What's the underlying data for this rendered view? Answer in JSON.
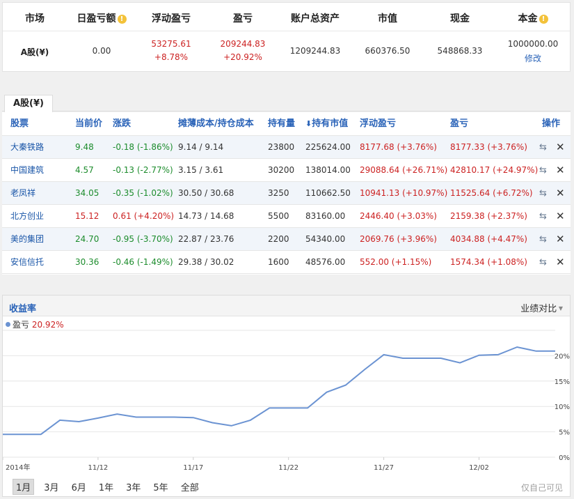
{
  "summary": {
    "headers": {
      "market": "市场",
      "daily_pl": "日盈亏额",
      "floating_pl": "浮动盈亏",
      "pl": "盈亏",
      "total_assets": "账户总资产",
      "market_value": "市值",
      "cash": "现金",
      "principal": "本金"
    },
    "row": {
      "market": "A股(¥)",
      "daily_pl": "0.00",
      "floating_pl": "53275.61",
      "floating_pl_pct": "+8.78%",
      "pl": "209244.83",
      "pl_pct": "+20.92%",
      "total_assets": "1209244.83",
      "market_value": "660376.50",
      "cash": "548868.33",
      "principal": "1000000.00",
      "edit_label": "修改"
    }
  },
  "tab": {
    "label": "A股(¥)"
  },
  "holdings": {
    "columns": {
      "stock": "股票",
      "price": "当前价",
      "change": "涨跌",
      "cost": "摊薄成本/持仓成本",
      "qty": "持有量",
      "market_value": "持有市值",
      "floating_pl": "浮动盈亏",
      "pl": "盈亏",
      "ops": "操作"
    },
    "sort_arrow": "⬇",
    "rows": [
      {
        "name": "大秦铁路",
        "price": "9.48",
        "change": "-0.18 (-1.86%)",
        "dir": "down",
        "cost": "9.14 / 9.14",
        "qty": "23800",
        "mv": "225624.00",
        "fpl": "8177.68 (+3.76%)",
        "pl": "8177.33 (+3.76%)"
      },
      {
        "name": "中国建筑",
        "price": "4.57",
        "change": "-0.13 (-2.77%)",
        "dir": "down",
        "cost": "3.15 / 3.61",
        "qty": "30200",
        "mv": "138014.00",
        "fpl": "29088.64 (+26.71%)",
        "pl": "42810.17 (+24.97%)"
      },
      {
        "name": "老凤祥",
        "price": "34.05",
        "change": "-0.35 (-1.02%)",
        "dir": "down",
        "cost": "30.50 / 30.68",
        "qty": "3250",
        "mv": "110662.50",
        "fpl": "10941.13 (+10.97%)",
        "pl": "11525.64 (+6.72%)"
      },
      {
        "name": "北方创业",
        "price": "15.12",
        "change": "0.61 (+4.20%)",
        "dir": "up",
        "cost": "14.73 / 14.68",
        "qty": "5500",
        "mv": "83160.00",
        "fpl": "2446.40 (+3.03%)",
        "pl": "2159.38 (+2.37%)"
      },
      {
        "name": "美的集团",
        "price": "24.70",
        "change": "-0.95 (-3.70%)",
        "dir": "down",
        "cost": "22.87 / 23.76",
        "qty": "2200",
        "mv": "54340.00",
        "fpl": "2069.76 (+3.96%)",
        "pl": "4034.88 (+4.47%)"
      },
      {
        "name": "安信信托",
        "price": "30.36",
        "change": "-0.46 (-1.49%)",
        "dir": "down",
        "cost": "29.38 / 30.02",
        "qty": "1600",
        "mv": "48576.00",
        "fpl": "552.00 (+1.15%)",
        "pl": "1574.34 (+1.08%)"
      }
    ]
  },
  "chart_panel": {
    "title": "收益率",
    "compare_label": "业绩对比",
    "legend_name": "盈亏",
    "legend_value": "20.92%",
    "ranges": [
      "1月",
      "3月",
      "6月",
      "1年",
      "3年",
      "5年",
      "全部"
    ],
    "selected_range": "1月",
    "footnote": "仅自己可见"
  },
  "colors": {
    "up": "#cc2222",
    "down": "#1c8c2c",
    "link": "#2a63b8",
    "line": "#6b93d2"
  },
  "chart_data": {
    "type": "line",
    "series": [
      {
        "name": "盈亏",
        "values": [
          4.5,
          4.5,
          4.5,
          7.3,
          7.0,
          7.7,
          8.5,
          7.9,
          7.9,
          7.9,
          7.8,
          6.8,
          6.2,
          7.3,
          9.7,
          9.7,
          9.7,
          12.8,
          14.2,
          17.3,
          20.2,
          19.5,
          19.5,
          19.5,
          18.6,
          20.1,
          20.2,
          21.7,
          20.9,
          20.9
        ]
      }
    ],
    "x_tick_labels": [
      "2014年",
      "11/12",
      "11/17",
      "11/22",
      "11/27",
      "12/02"
    ],
    "y_tick_labels": [
      "0%",
      "5%",
      "10%",
      "15%",
      "20%"
    ],
    "ylim": [
      0,
      25
    ],
    "y_axis_side": "right",
    "grid": true
  }
}
